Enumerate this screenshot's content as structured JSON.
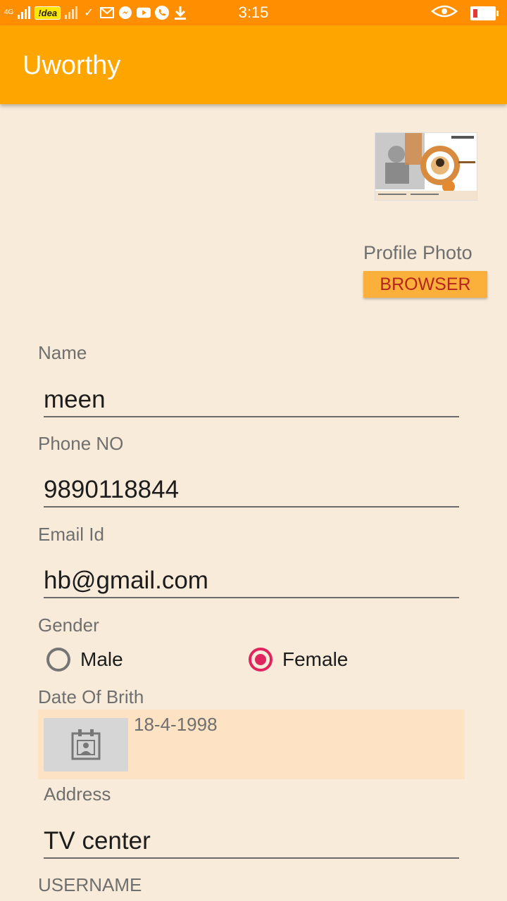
{
  "status_bar": {
    "network": "4G",
    "carrier": "!dea",
    "time": "3:15",
    "icons": [
      "signal-icon",
      "carrier-badge",
      "no-signal-icon",
      "check-icon",
      "gmail-icon",
      "messenger-icon",
      "youtube-icon",
      "phone-icon",
      "download-icon",
      "eye-icon",
      "battery-low-icon"
    ]
  },
  "app": {
    "title": "Uworthy",
    "accent": "#ffa500",
    "status_color": "#ff8f00"
  },
  "profile": {
    "label": "Profile Photo",
    "button": "BROWSER"
  },
  "form": {
    "name": {
      "label": "Name",
      "value": "meen"
    },
    "phone": {
      "label": "Phone NO",
      "value": "9890118844"
    },
    "email": {
      "label": "Email Id",
      "value": "hb@gmail.com"
    },
    "gender": {
      "label": "Gender",
      "options": [
        {
          "label": "Male",
          "checked": false
        },
        {
          "label": "Female",
          "checked": true
        }
      ]
    },
    "dob": {
      "label": "Date Of Brith",
      "value": "18-4-1998"
    },
    "address": {
      "label": "Address",
      "value": "TV center"
    },
    "username": {
      "label": "USERNAME"
    }
  }
}
